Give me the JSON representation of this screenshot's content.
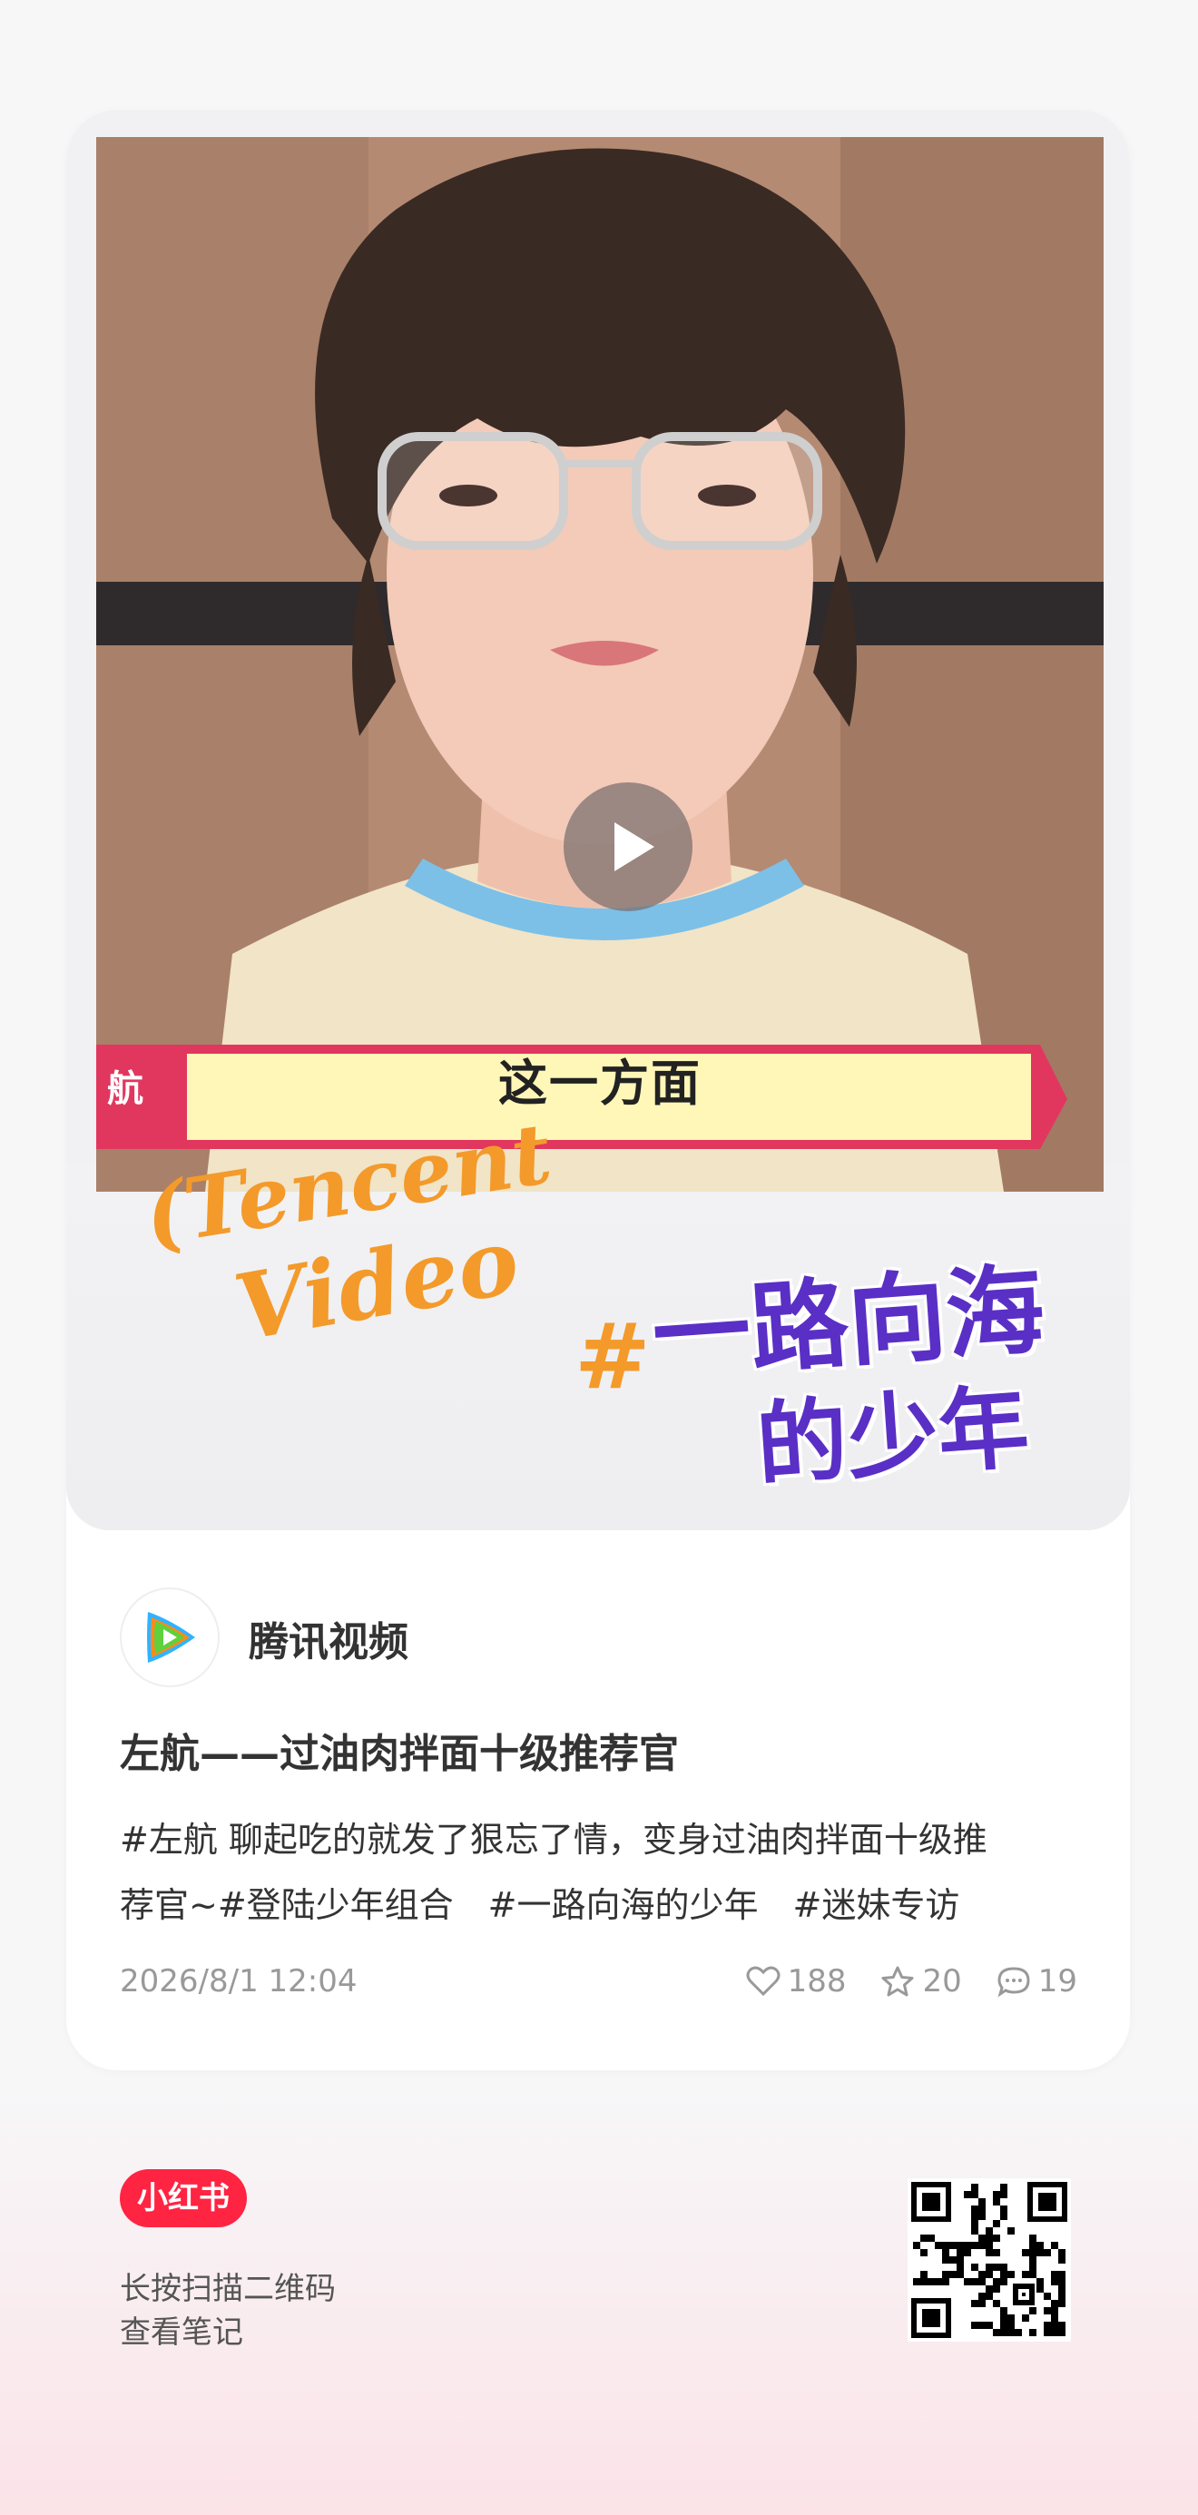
{
  "cover": {
    "banner_text": "这一方面",
    "watermark_line1": "(Tencent",
    "watermark_line2": "Video",
    "show_logo_hash": "#",
    "show_logo_line1": "一路向海",
    "show_logo_line2": "的少年",
    "banner_side_text": "航"
  },
  "author": {
    "name": "腾讯视频"
  },
  "post": {
    "title": "左航——过油肉拌面十级推荐官",
    "desc_line1": "#左航 聊起吃的就发了狠忘了情，变身过油肉拌面十级推",
    "desc_line2": "荐官~#登陆少年组合　#一路向海的少年　#迷妹专访",
    "date": "2026/8/1 12:04",
    "likes": "188",
    "collects": "20",
    "comments": "19"
  },
  "footer": {
    "logo_text": "小红书",
    "scan_line1": "长按扫描二维码",
    "scan_line2": "查看笔记"
  },
  "colors": {
    "brand": "#ff2442",
    "watermark": "#f39a2b",
    "show_logo": "#5a2fc6"
  }
}
